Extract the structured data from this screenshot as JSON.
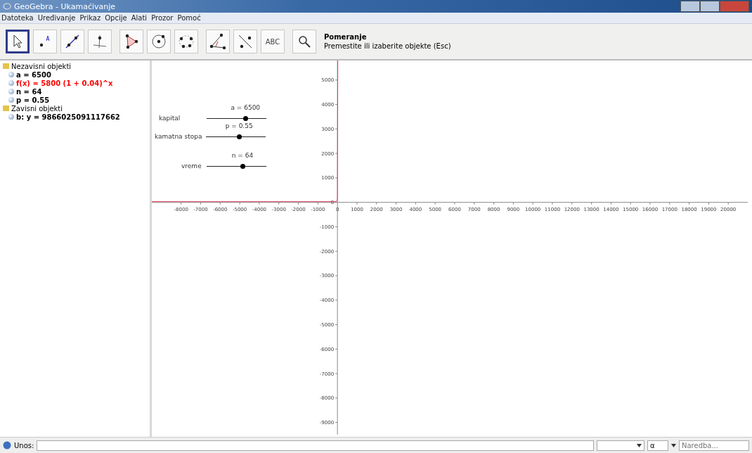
{
  "window": {
    "title": "GeoGebra - Ukamaćivanje"
  },
  "menu": [
    "Datoteka",
    "Uređivanje",
    "Prikaz",
    "Opcije",
    "Alati",
    "Prozor",
    "Pomoć"
  ],
  "toolbar": {
    "tools": [
      {
        "kind": "move",
        "selected": true
      },
      {
        "kind": "point",
        "selected": false
      },
      {
        "kind": "line",
        "selected": false
      },
      {
        "kind": "perpendicular",
        "selected": false
      },
      {
        "kind": "polygon",
        "selected": false
      },
      {
        "kind": "circle",
        "selected": false
      },
      {
        "kind": "conic",
        "selected": false
      },
      {
        "kind": "angle",
        "selected": false
      },
      {
        "kind": "reflect",
        "selected": false
      },
      {
        "kind": "text",
        "label": "ABC",
        "selected": false
      },
      {
        "kind": "zoom",
        "selected": false
      }
    ],
    "tool_name": "Pomeranje",
    "tool_help": "Premestite ili izaberite objekte (Esc)"
  },
  "algebra": {
    "folders": [
      {
        "label": "Nezavisni objekti",
        "children": [
          {
            "label": "a = 6500",
            "color": "#000000"
          },
          {
            "label": "f(x) = 5800 (1 + 0.04)^x",
            "color": "#ff0000"
          },
          {
            "label": "n = 64",
            "color": "#000000"
          },
          {
            "label": "p = 0.55",
            "color": "#000000"
          }
        ]
      },
      {
        "label": "Zavisni objekti",
        "children": [
          {
            "label": "b: y = 9866025091117662",
            "color": "#000000"
          }
        ]
      }
    ]
  },
  "graphics": {
    "sliders": [
      {
        "label": "kapital",
        "value": "a = 6500",
        "level": 0.65
      },
      {
        "label": "kamatna stopa",
        "value": "p = 0.55",
        "level": 0.55
      },
      {
        "label": "vreme",
        "value": "n = 64",
        "level": 0.6
      }
    ],
    "chart_data": {
      "type": "line",
      "xlim": [
        -9500,
        21000
      ],
      "ylim": [
        -9500,
        5800
      ],
      "xticks": [
        -8000,
        -7000,
        -6000,
        -5000,
        -4000,
        -3000,
        -2000,
        -1000,
        0,
        1000,
        2000,
        3000,
        4000,
        5000,
        6000,
        7000,
        8000,
        9000,
        10000,
        11000,
        12000,
        13000,
        14000,
        15000,
        16000,
        17000,
        18000,
        19000,
        20000
      ],
      "yticks": [
        -9000,
        -8000,
        -7000,
        -6000,
        -5000,
        -4000,
        -3000,
        -2000,
        -1000,
        0,
        1000,
        2000,
        3000,
        4000,
        5000
      ]
    }
  },
  "input_bar": {
    "label": "Unos:",
    "symbol": "α",
    "command_placeholder": "Naredba..."
  }
}
